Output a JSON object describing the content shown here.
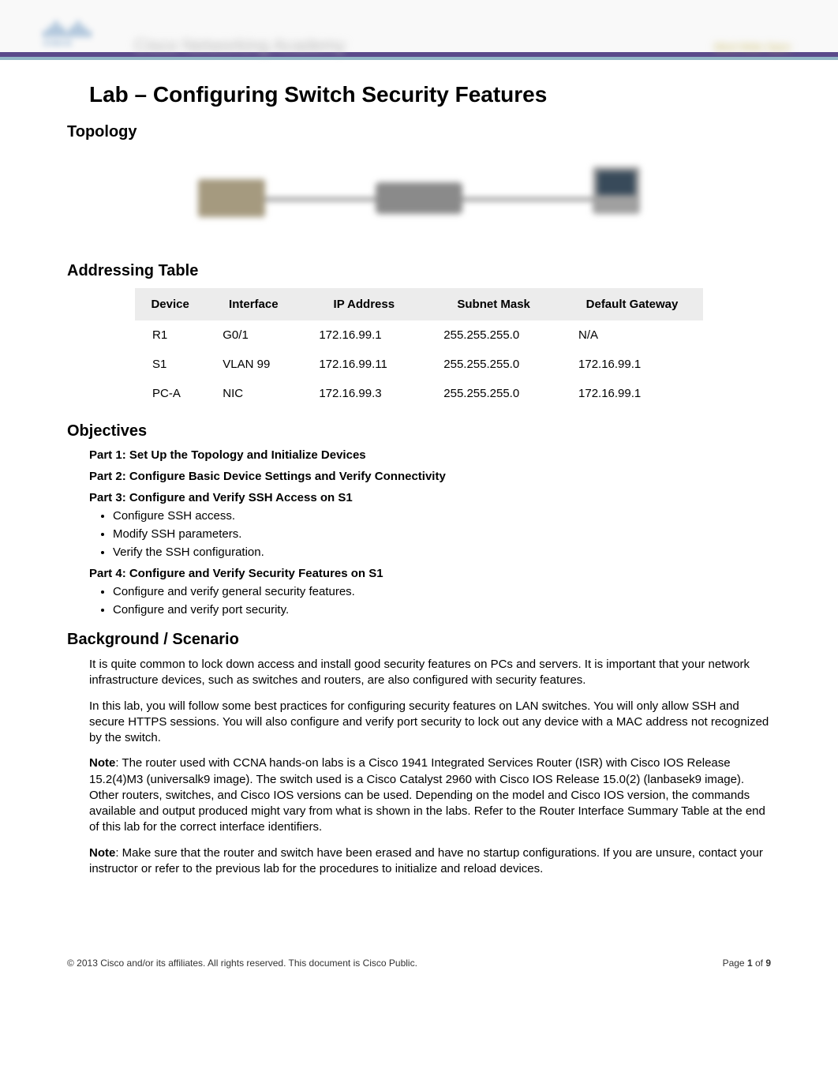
{
  "header": {
    "academy_text": "Cisco Networking Academy",
    "right_slogan": "Mind Wide Open"
  },
  "title": "Lab – Configuring Switch Security Features",
  "sections": {
    "topology": "Topology",
    "addressing": "Addressing Table",
    "objectives": "Objectives",
    "background": "Background / Scenario"
  },
  "addressing_table": {
    "headers": {
      "device": "Device",
      "interface": "Interface",
      "ip": "IP Address",
      "mask": "Subnet Mask",
      "gateway": "Default Gateway"
    },
    "rows": [
      {
        "device": "R1",
        "interface": "G0/1",
        "ip": "172.16.99.1",
        "mask": "255.255.255.0",
        "gateway": "N/A"
      },
      {
        "device": "S1",
        "interface": "VLAN 99",
        "ip": "172.16.99.11",
        "mask": "255.255.255.0",
        "gateway": "172.16.99.1"
      },
      {
        "device": "PC-A",
        "interface": "NIC",
        "ip": "172.16.99.3",
        "mask": "255.255.255.0",
        "gateway": "172.16.99.1"
      }
    ]
  },
  "objectives": {
    "part1": "Part 1: Set Up the Topology and Initialize Devices",
    "part2": "Part 2: Configure Basic Device Settings and Verify Connectivity",
    "part3": {
      "title": "Part 3: Configure and Verify SSH Access on S1",
      "bullets": [
        "Configure SSH access.",
        "Modify SSH parameters.",
        "Verify the SSH configuration."
      ]
    },
    "part4": {
      "title": "Part 4: Configure and Verify Security Features on S1",
      "bullets": [
        "Configure and verify general security features.",
        "Configure and verify port security."
      ]
    }
  },
  "background_paragraphs": {
    "p1": "It is quite common to lock down access and install good security features on PCs and servers. It is important that your network infrastructure devices, such as switches and routers, are also configured with security features.",
    "p2": "In this lab, you will follow some best practices for configuring security features on LAN switches. You will only allow SSH and secure HTTPS sessions. You will also configure and verify port security to lock out any device with a MAC address not recognized by the switch.",
    "note1_label": "Note",
    "note1_text": ": The router used with CCNA hands-on labs is a Cisco 1941 Integrated Services Router (ISR) with Cisco IOS Release 15.2(4)M3 (universalk9 image). The switch used is a Cisco Catalyst 2960 with Cisco IOS Release 15.0(2) (lanbasek9 image). Other routers, switches, and Cisco IOS versions can be used. Depending on the model and Cisco IOS version, the commands available and output produced might vary from what is shown in the labs. Refer to the Router Interface Summary Table at the end of this lab for the correct interface identifiers.",
    "note2_label": "Note",
    "note2_text": ": Make sure that the router and switch have been erased and have no startup configurations. If you are unsure, contact your instructor or refer to the previous lab for the procedures to initialize and reload devices."
  },
  "footer": {
    "copyright": "© 2013 Cisco and/or its affiliates. All rights reserved. This document is Cisco Public.",
    "page_prefix": "Page ",
    "page_num": "1",
    "page_of": " of ",
    "page_total": "9"
  }
}
